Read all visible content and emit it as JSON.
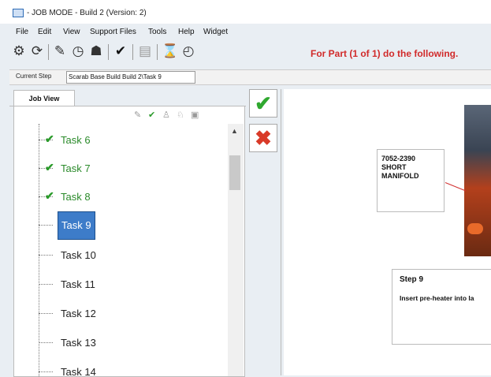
{
  "window": {
    "title": "- JOB MODE - Build 2 (Version: 2)"
  },
  "menu": [
    "File",
    "Edit",
    "View",
    "Support Files",
    "Tools",
    "Help",
    "Widget"
  ],
  "toolbar": {
    "icons": [
      "gear-icon",
      "refresh-icon",
      "edit-icon",
      "clock-icon",
      "user-icon",
      "check-circle-icon",
      "document-icon",
      "hourglass-icon",
      "timer-icon"
    ],
    "instruction": "For Part (1 of 1) do the following."
  },
  "current_step": {
    "label": "Current Step",
    "value": "Scarab Base Build Build 2\\Task 9"
  },
  "tabs": [
    {
      "label": "Job View"
    }
  ],
  "tree": {
    "items": [
      {
        "label": "Task 6",
        "status": "done"
      },
      {
        "label": "Task 7",
        "status": "done"
      },
      {
        "label": "Task 8",
        "status": "done"
      },
      {
        "label": "Task 9",
        "status": "selected"
      },
      {
        "label": "Task 10",
        "status": "pending"
      },
      {
        "label": "Task 11",
        "status": "pending"
      },
      {
        "label": "Task 12",
        "status": "pending"
      },
      {
        "label": "Task 13",
        "status": "pending"
      },
      {
        "label": "Task 14",
        "status": "pending"
      }
    ]
  },
  "content": {
    "callout": "7052-2390\nSHORT\nMANIFOLD",
    "step_title": "Step 9",
    "step_text": "Insert pre-heater into la"
  },
  "colors": {
    "accent": "#3d7cc9",
    "done": "#2a9a2a",
    "alert": "#d12a2a"
  }
}
